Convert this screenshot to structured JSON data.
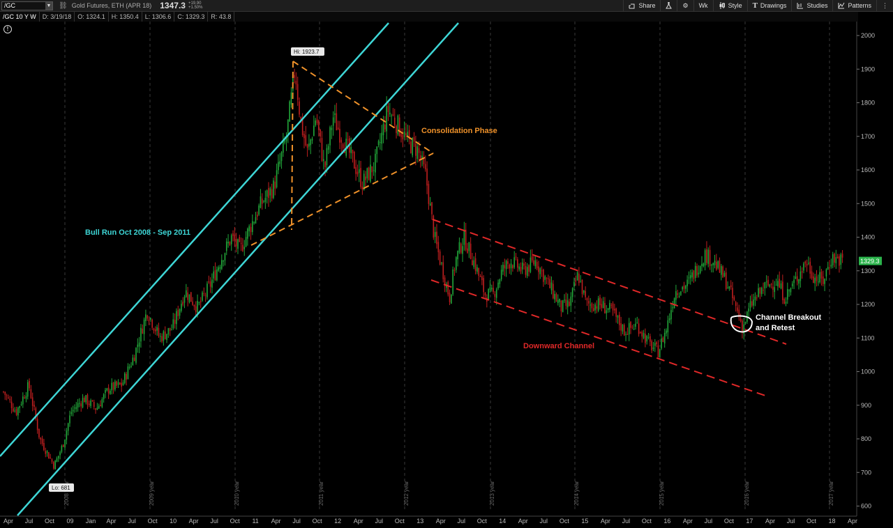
{
  "header": {
    "symbol": "/GC",
    "description": "Gold Futures, ETH (APR 18)",
    "last_price": "1347.3",
    "change_abs": "+19.90",
    "change_pct": "+1.50%"
  },
  "toolbar": {
    "share": "Share",
    "timeframe": "Wk",
    "style": "Style",
    "drawings": "Drawings",
    "studies": "Studies",
    "patterns": "Patterns"
  },
  "info": {
    "chart_label": "/GC 10 Y W",
    "date": "D: 3/19/18",
    "open": "O: 1324.1",
    "high": "H: 1350.4",
    "low": "L: 1306.6",
    "close": "C: 1329.3",
    "range": "R: 43.8"
  },
  "price_axis": {
    "ticks": [
      "2000",
      "1900",
      "1800",
      "1700",
      "1600",
      "1500",
      "1400",
      "1300",
      "1200",
      "1100",
      "1000",
      "900",
      "800",
      "700",
      "600"
    ],
    "current_label": "1329.3",
    "current_color": "#2bb34b"
  },
  "time_axis": {
    "labels": [
      "Apr",
      "Jul",
      "Oct",
      "09",
      "Jan",
      "Apr",
      "Jul",
      "Oct",
      "10",
      "Apr",
      "Jul",
      "Oct",
      "11",
      "Apr",
      "Jul",
      "Oct",
      "12",
      "Apr",
      "Jul",
      "Oct",
      "13",
      "Apr",
      "Jul",
      "Oct",
      "14",
      "Apr",
      "Jul",
      "Oct",
      "15",
      "Apr",
      "Jul",
      "Oct",
      "16",
      "Apr",
      "Jul",
      "Oct",
      "17",
      "Apr",
      "Jul",
      "Oct",
      "18",
      "Apr"
    ],
    "year_markers": [
      "2008 year",
      "2009 year",
      "2010 year",
      "2011 year",
      "2012 year",
      "2013 year",
      "2014 year",
      "2015 year",
      "2016 year",
      "2017 year"
    ]
  },
  "annotations": {
    "high_tag": "Hi: 1923.7",
    "low_tag": "Lo: 681",
    "bull_run": "Bull Run Oct 2008 - Sep 2011",
    "consolidation": "Consolidation Phase",
    "downward_channel": "Downward Channel",
    "breakout_line1": "Channel Breakout",
    "breakout_line2": "and Retest"
  },
  "colors": {
    "up_candle": "#22a83a",
    "down_candle": "#c01f1f",
    "bull_channel": "#3ed6d6",
    "consolidation": "#f0922a",
    "downward_channel": "#e02828"
  },
  "price_path": [
    [
      2008.2,
      940
    ],
    [
      2008.35,
      880
    ],
    [
      2008.5,
      960
    ],
    [
      2008.63,
      800
    ],
    [
      2008.8,
      720
    ],
    [
      2008.9,
      780
    ],
    [
      2009.0,
      880
    ],
    [
      2009.15,
      920
    ],
    [
      2009.3,
      890
    ],
    [
      2009.45,
      950
    ],
    [
      2009.6,
      960
    ],
    [
      2009.75,
      1050
    ],
    [
      2009.9,
      1180
    ],
    [
      2010.05,
      1100
    ],
    [
      2010.2,
      1130
    ],
    [
      2010.35,
      1240
    ],
    [
      2010.5,
      1190
    ],
    [
      2010.65,
      1260
    ],
    [
      2010.8,
      1350
    ],
    [
      2010.9,
      1400
    ],
    [
      2011.0,
      1360
    ],
    [
      2011.1,
      1420
    ],
    [
      2011.25,
      1500
    ],
    [
      2011.4,
      1550
    ],
    [
      2011.55,
      1700
    ],
    [
      2011.65,
      1900
    ],
    [
      2011.72,
      1740
    ],
    [
      2011.8,
      1650
    ],
    [
      2011.9,
      1760
    ],
    [
      2012.0,
      1600
    ],
    [
      2012.1,
      1760
    ],
    [
      2012.2,
      1700
    ],
    [
      2012.35,
      1620
    ],
    [
      2012.45,
      1560
    ],
    [
      2012.6,
      1620
    ],
    [
      2012.75,
      1780
    ],
    [
      2012.9,
      1720
    ],
    [
      2013.0,
      1680
    ],
    [
      2013.1,
      1660
    ],
    [
      2013.2,
      1580
    ],
    [
      2013.3,
      1400
    ],
    [
      2013.4,
      1300
    ],
    [
      2013.48,
      1220
    ],
    [
      2013.55,
      1330
    ],
    [
      2013.65,
      1400
    ],
    [
      2013.78,
      1320
    ],
    [
      2013.9,
      1230
    ],
    [
      2014.0,
      1230
    ],
    [
      2014.1,
      1300
    ],
    [
      2014.2,
      1330
    ],
    [
      2014.35,
      1300
    ],
    [
      2014.5,
      1330
    ],
    [
      2014.65,
      1260
    ],
    [
      2014.8,
      1190
    ],
    [
      2014.9,
      1200
    ],
    [
      2015.0,
      1290
    ],
    [
      2015.1,
      1200
    ],
    [
      2015.25,
      1200
    ],
    [
      2015.4,
      1180
    ],
    [
      2015.55,
      1120
    ],
    [
      2015.7,
      1140
    ],
    [
      2015.85,
      1080
    ],
    [
      2015.95,
      1060
    ],
    [
      2016.05,
      1130
    ],
    [
      2016.15,
      1240
    ],
    [
      2016.3,
      1260
    ],
    [
      2016.5,
      1350
    ],
    [
      2016.6,
      1330
    ],
    [
      2016.75,
      1270
    ],
    [
      2016.9,
      1170
    ],
    [
      2016.95,
      1130
    ],
    [
      2017.05,
      1200
    ],
    [
      2017.2,
      1250
    ],
    [
      2017.35,
      1270
    ],
    [
      2017.45,
      1220
    ],
    [
      2017.55,
      1260
    ],
    [
      2017.7,
      1330
    ],
    [
      2017.8,
      1280
    ],
    [
      2017.9,
      1270
    ],
    [
      2018.0,
      1340
    ],
    [
      2018.15,
      1329
    ]
  ],
  "chart_data": {
    "type": "line",
    "title": "/GC 10 Y W",
    "ylabel": "",
    "ylim": [
      580,
      2050
    ],
    "xlim": [
      2008.2,
      2018.25
    ],
    "high": 1923.7,
    "low": 681,
    "last": 1329.3
  }
}
